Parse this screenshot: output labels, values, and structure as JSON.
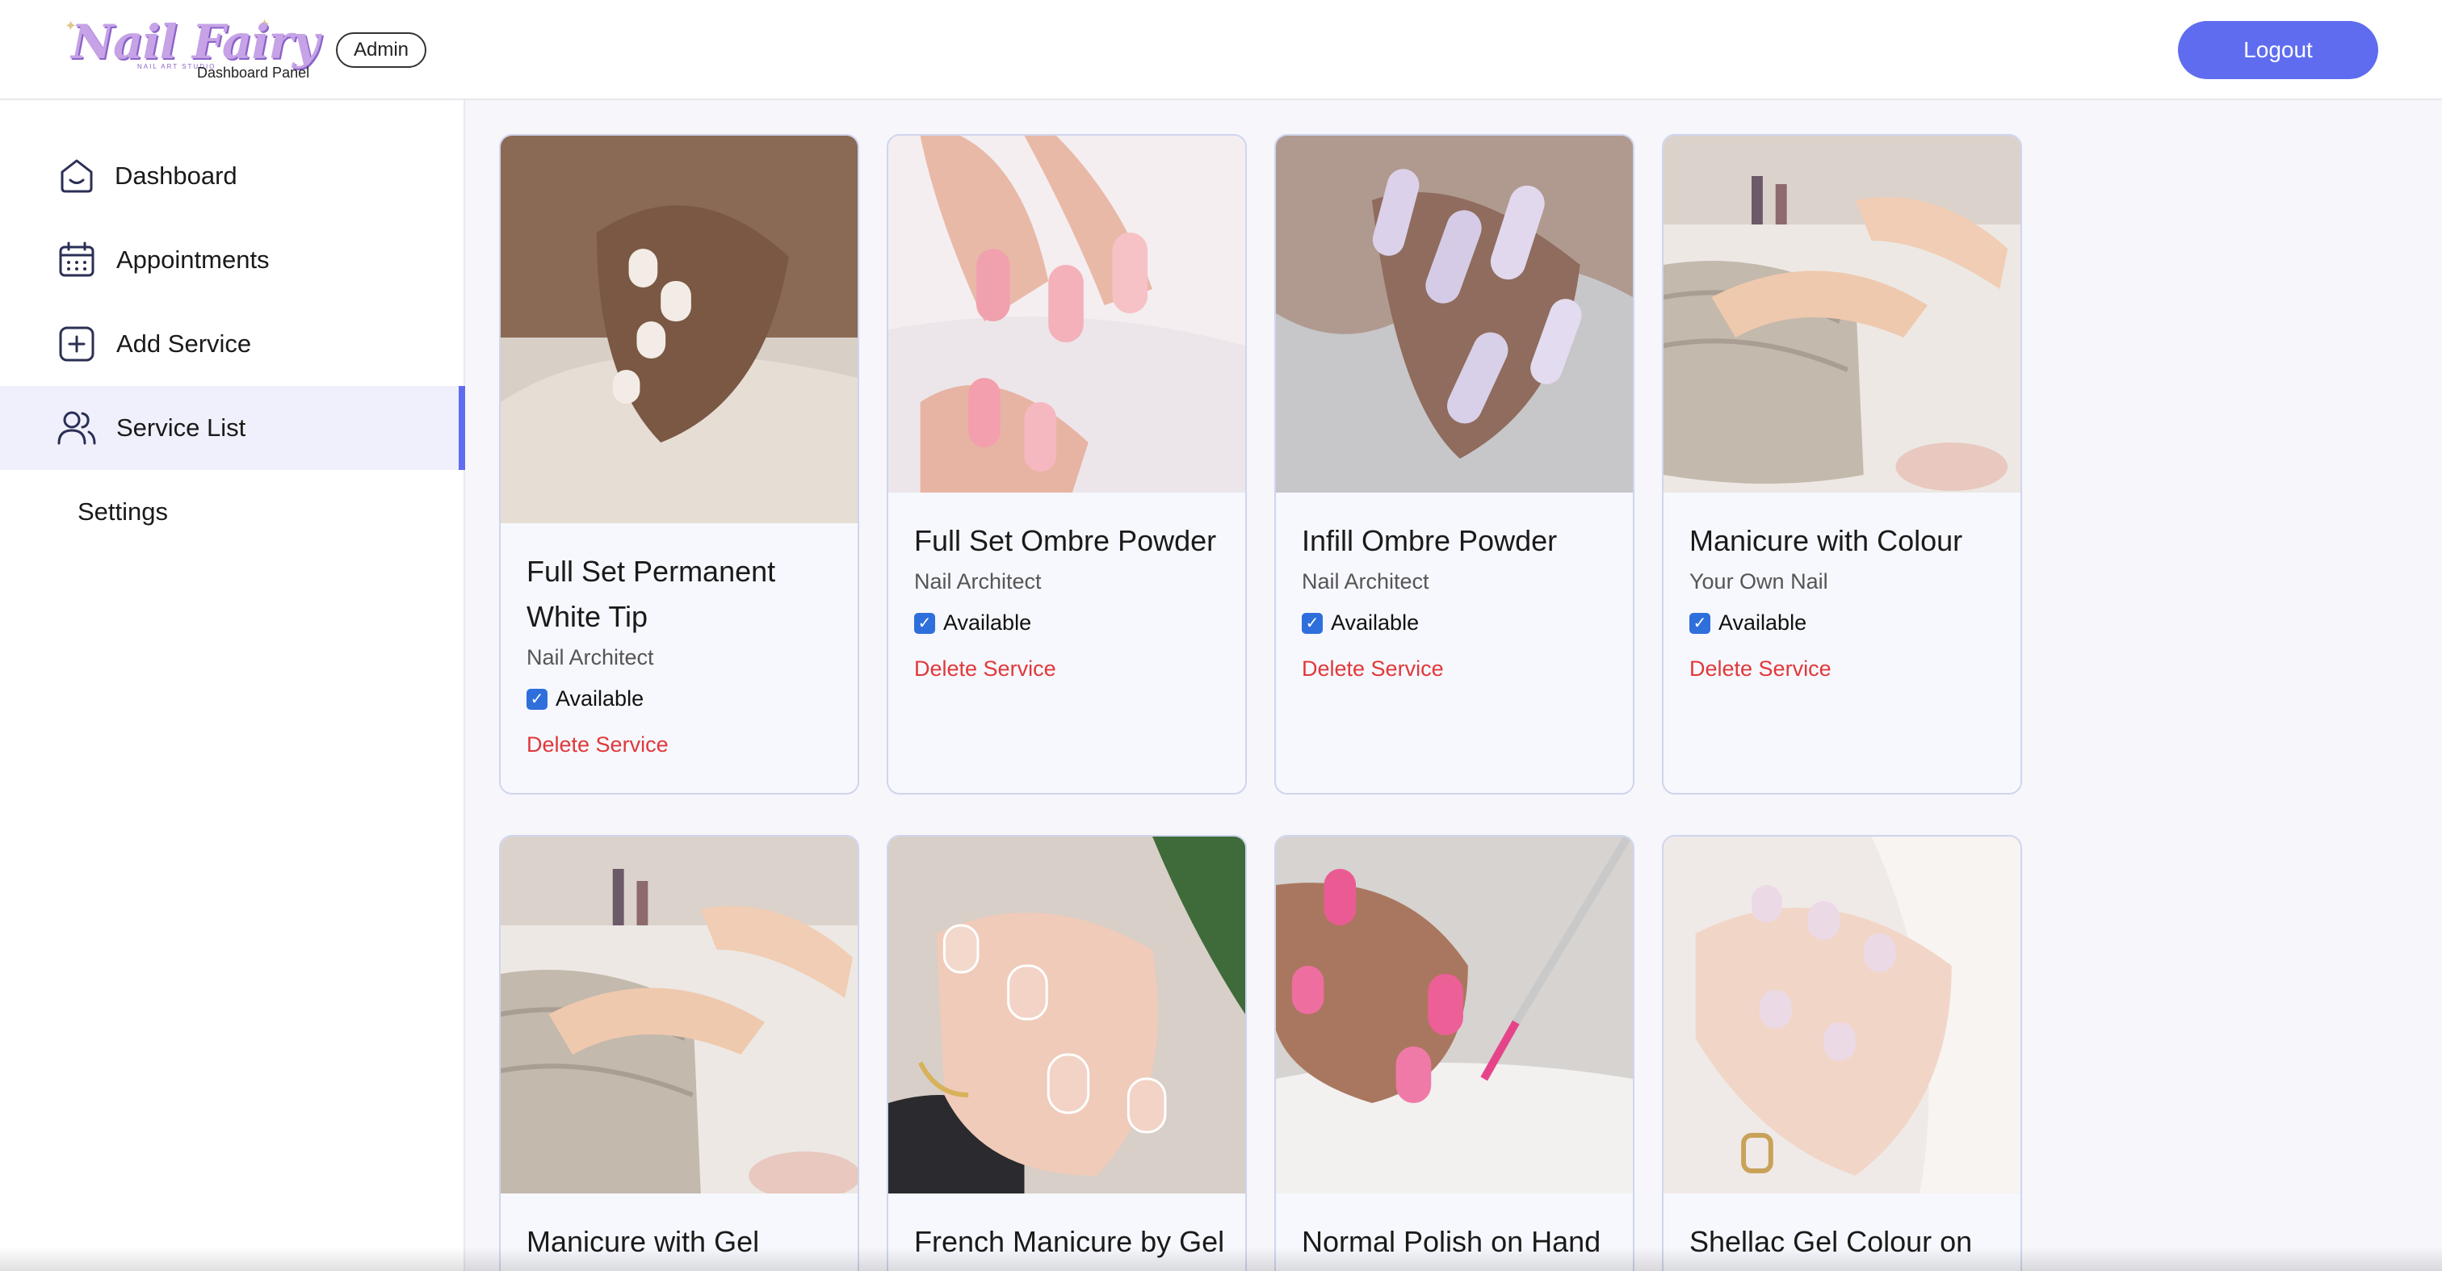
{
  "header": {
    "logo_text": "Nail Fairy",
    "logo_tagline": "NAIL ART STUDIO",
    "logo_subtitle": "Dashboard Panel",
    "role_badge": "Admin",
    "logout_label": "Logout"
  },
  "sidebar": {
    "items": [
      {
        "label": "Dashboard",
        "icon": "home-icon"
      },
      {
        "label": "Appointments",
        "icon": "calendar-icon"
      },
      {
        "label": "Add Service",
        "icon": "add-square-icon"
      },
      {
        "label": "Service List",
        "icon": "users-icon",
        "active": true
      },
      {
        "label": "Settings"
      }
    ]
  },
  "services": [
    {
      "title": "Full Set Permanent White Tip",
      "subtitle": "Nail Architect",
      "available_label": "Available",
      "available": true,
      "delete_label": "Delete Service"
    },
    {
      "title": "Full Set Ombre Powder",
      "subtitle": "Nail Architect",
      "available_label": "Available",
      "available": true,
      "delete_label": "Delete Service"
    },
    {
      "title": "Infill Ombre Powder",
      "subtitle": "Nail Architect",
      "available_label": "Available",
      "available": true,
      "delete_label": "Delete Service"
    },
    {
      "title": "Manicure with Colour",
      "subtitle": "Your Own Nail",
      "available_label": "Available",
      "available": true,
      "delete_label": "Delete Service"
    },
    {
      "title": "Manicure with Gel"
    },
    {
      "title": "French Manicure by Gel"
    },
    {
      "title": "Normal Polish on Hand"
    },
    {
      "title": "Shellac Gel Colour on"
    }
  ],
  "colors": {
    "accent": "#5f6cf0",
    "delete": "#e0383a",
    "checkbox": "#2f6fdc",
    "card_border": "#cfd5ee"
  }
}
